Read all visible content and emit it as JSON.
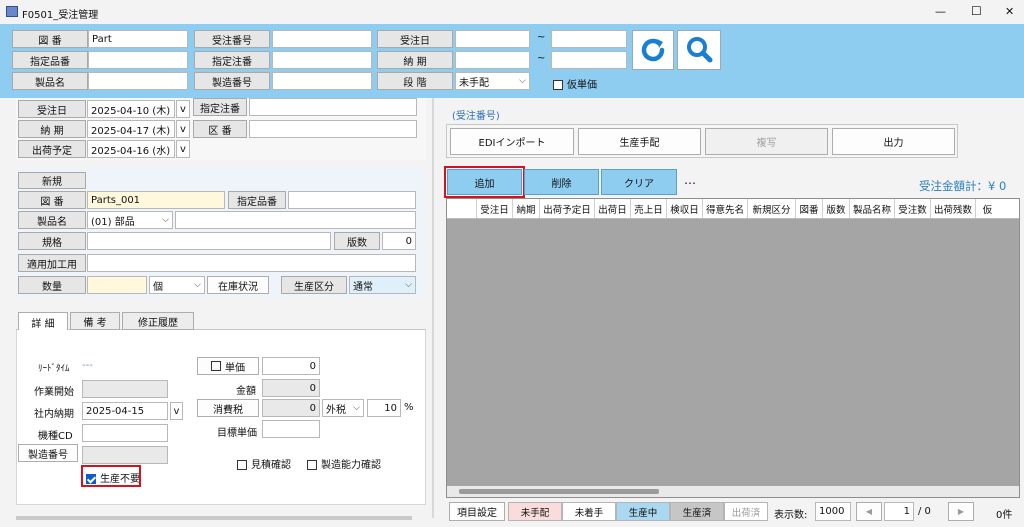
{
  "window": {
    "title": "F0501_受注管理",
    "minimize": "—",
    "maximize": "☐",
    "close": "✕"
  },
  "search": {
    "zuban_label": "図 番",
    "zuban_value": "Part",
    "shitei_hinban_label": "指定品番",
    "seihinmei_label": "製品名",
    "juchu_bango_label": "受注番号",
    "shitei_chuban_label": "指定注番",
    "seizo_bango_label": "製造番号",
    "juchubi_label": "受注日",
    "noki_label": "納 期",
    "dankai_label": "段 階",
    "dankai_value": "未手配",
    "tilde": "~",
    "kari_tanka_label": "仮単価"
  },
  "order": {
    "juchubi_label": "受注日",
    "juchubi_value": "2025-04-10 (木)",
    "noki_label": "納 期",
    "noki_value": "2025-04-17 (木)",
    "shukka_label": "出荷予定",
    "shukka_value": "2025-04-16 (水)",
    "v": "v",
    "shitei_chuban_label": "指定注番",
    "kuban_label": "区 番"
  },
  "item": {
    "shinki_label": "新規",
    "zuban_label": "図 番",
    "zuban_value": "Parts_001",
    "shitei_hinban_label": "指定品番",
    "seihinmei_label": "製品名",
    "seihinmei_value": "(01) 部品",
    "kikaku_label": "規格",
    "hansu_label": "版数",
    "hansu_value": "0",
    "tekiyo_label": "適用加工用",
    "suryo_label": "数量",
    "unit_value": "個",
    "zaiko_button": "在庫状況",
    "seisan_kubun_label": "生産区分",
    "seisan_kubun_value": "通常"
  },
  "tabs": [
    "詳 細",
    "備 考",
    "修正履歴"
  ],
  "detail": {
    "leadtime_label": "ﾘｰﾄﾞﾀｲﾑ",
    "leadtime_value": "---",
    "sagyo_label": "作業開始",
    "shanai_label": "社内納期",
    "shanai_value": "2025-04-15",
    "v": "v",
    "kikai_label": "機種CD",
    "seizo_button": "製造番号",
    "seisan_fuyo_label": "生産不要",
    "tanka_label": "単価",
    "tanka_value": "0",
    "kingaku_label": "金額",
    "kingaku_value": "0",
    "shohizei_label": "消費税",
    "shohizei_value": "0",
    "tax_mode": "外税",
    "tax_rate": "10",
    "percent": "%",
    "mokuhyo_label": "目標単価",
    "mitsumori_label": "見積確認",
    "noryoku_label": "製造能力確認"
  },
  "right": {
    "juchu_bango_link": "(受注番号)",
    "edi_button": "EDIインポート",
    "seisan_tehai_button": "生産手配",
    "fukusha_button": "複写",
    "shutsuryoku_button": "出力",
    "tsuika_button": "追加",
    "sakujo_button": "削除",
    "clear_button": "クリア",
    "more": "…",
    "total_label": "受注金額計：¥ 0"
  },
  "grid": {
    "columns": [
      "受注日",
      "納期",
      "出荷予定日",
      "出荷日",
      "売上日",
      "検収日",
      "得意先名",
      "新規区分",
      "図番",
      "版数",
      "製品名称",
      "受注数",
      "出荷残数",
      "仮"
    ]
  },
  "statusbar": {
    "koumoku_button": "項目設定",
    "mitehai": "未手配",
    "michakushu": "未着手",
    "seisanchu": "生産中",
    "seisanzumi": "生産済",
    "shukkazumi": "出荷済",
    "hyoji_label": "表示数:",
    "hyoji_value": "1000",
    "page_value": "1",
    "page_total": "/ 0",
    "count": "0件",
    "prev": "◀",
    "next": "▶"
  },
  "colors": {
    "header_bg": "#8ecdf0",
    "highlight": "#d2141e",
    "accent": "#1a7fd0"
  }
}
